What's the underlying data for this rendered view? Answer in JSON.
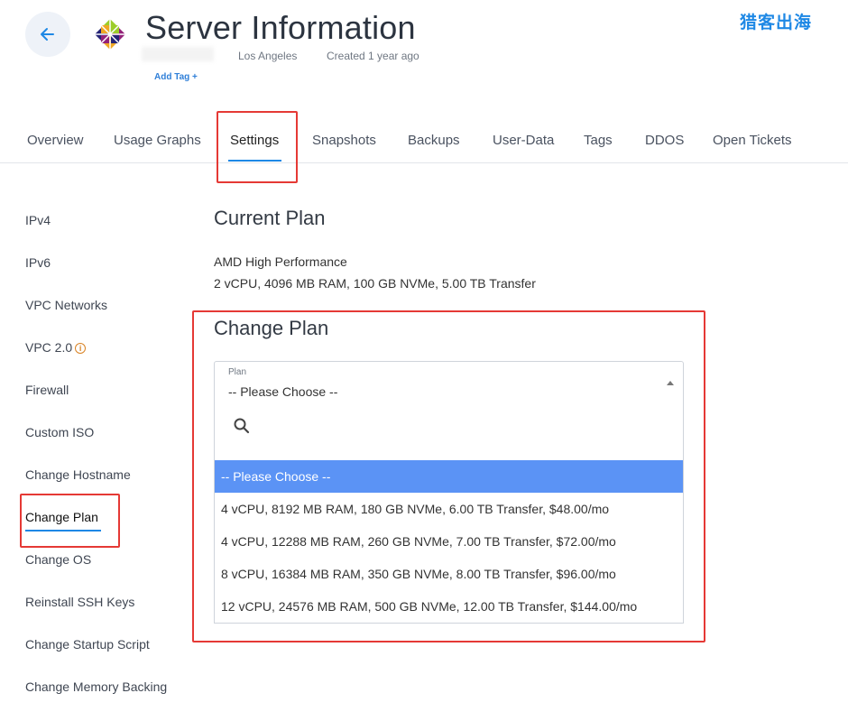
{
  "header": {
    "title": "Server Information",
    "location": "Los Angeles",
    "created": "Created 1 year ago",
    "add_tag": "Add Tag +",
    "brand": "猎客出海"
  },
  "tabs": [
    "Overview",
    "Usage Graphs",
    "Settings",
    "Snapshots",
    "Backups",
    "User-Data",
    "Tags",
    "DDOS",
    "Open Tickets"
  ],
  "active_tab": "Settings",
  "sidebar": {
    "items": [
      "IPv4",
      "IPv6",
      "VPC Networks",
      "VPC 2.0",
      "Firewall",
      "Custom ISO",
      "Change Hostname",
      "Change Plan",
      "Change OS",
      "Reinstall SSH Keys",
      "Change Startup Script",
      "Change Memory Backing"
    ],
    "active": "Change Plan"
  },
  "current_plan": {
    "heading": "Current Plan",
    "name": "AMD High Performance",
    "specs": "2 vCPU, 4096 MB RAM, 100 GB NVMe, 5.00 TB Transfer"
  },
  "change_plan": {
    "heading": "Change Plan",
    "select_label": "Plan",
    "select_value": "-- Please Choose --",
    "search_placeholder": "",
    "options": [
      "-- Please Choose --",
      "4 vCPU, 8192 MB RAM, 180 GB NVMe, 6.00 TB Transfer, $48.00/mo",
      "4 vCPU, 12288 MB RAM, 260 GB NVMe, 7.00 TB Transfer, $72.00/mo",
      "8 vCPU, 16384 MB RAM, 350 GB NVMe, 8.00 TB Transfer, $96.00/mo",
      "12 vCPU, 24576 MB RAM, 500 GB NVMe, 12.00 TB Transfer, $144.00/mo"
    ],
    "selected_index": 0
  },
  "colors": {
    "accent": "#1e88e5",
    "highlight_box": "#e53935",
    "selected_option": "#5b93f5",
    "info_icon": "#d98324"
  }
}
